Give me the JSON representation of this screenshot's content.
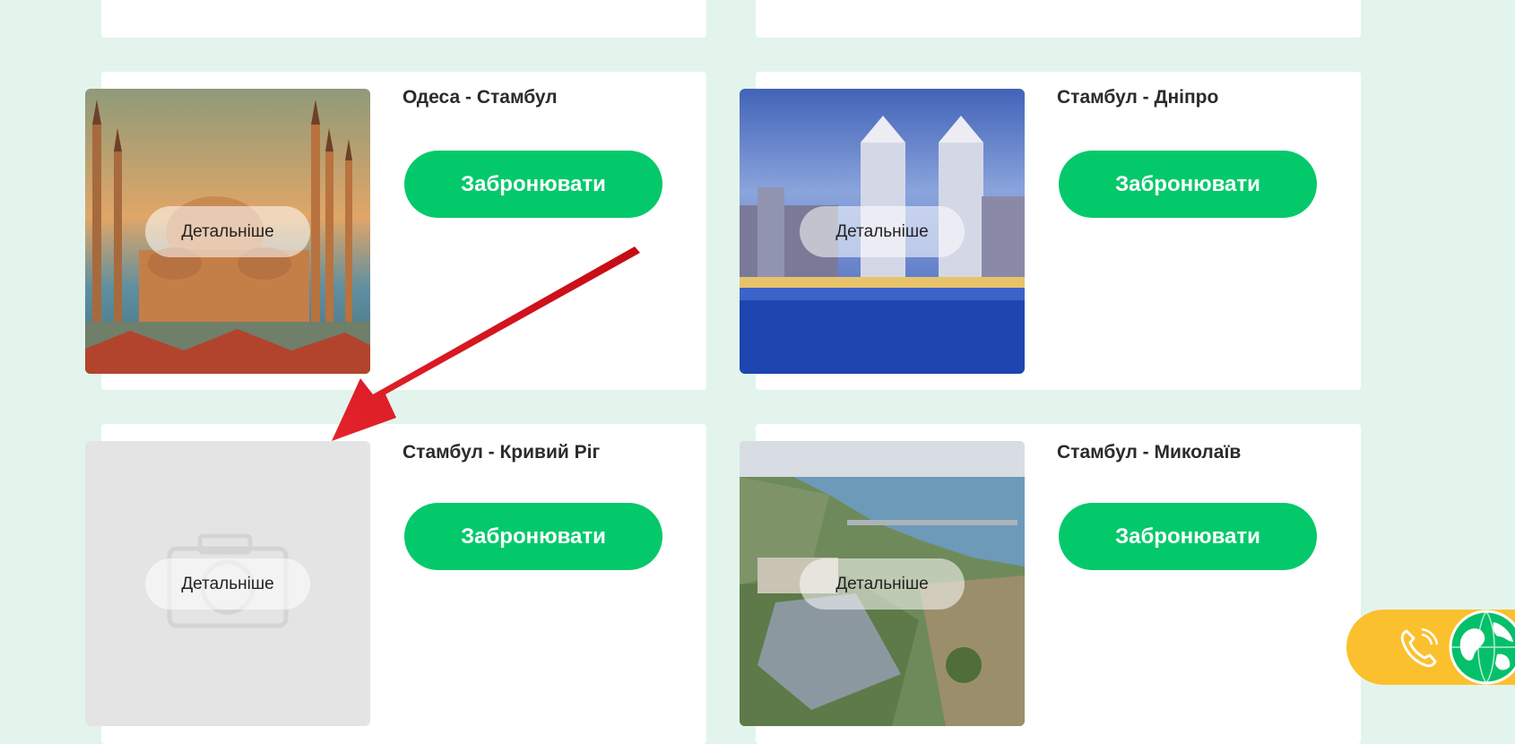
{
  "details_label": "Детальніше",
  "book_label": "Забронювати",
  "cards": [
    {
      "title": "Одеса - Стамбул",
      "image": "istanbul-mosque"
    },
    {
      "title": "Стамбул - Дніпро",
      "image": "dnipro-towers"
    },
    {
      "title": "Стамбул - Кривий Ріг",
      "image": "placeholder-camera"
    },
    {
      "title": "Стамбул - Миколаїв",
      "image": "mykolaiv-aerial"
    }
  ],
  "widget": {
    "icons": [
      "phone-icon",
      "globe-icon"
    ]
  },
  "colors": {
    "page_bg": "#e3f4ec",
    "button_green": "#04c96b",
    "widget_yellow": "#fbc02d",
    "arrow_red": "#d6121b"
  }
}
